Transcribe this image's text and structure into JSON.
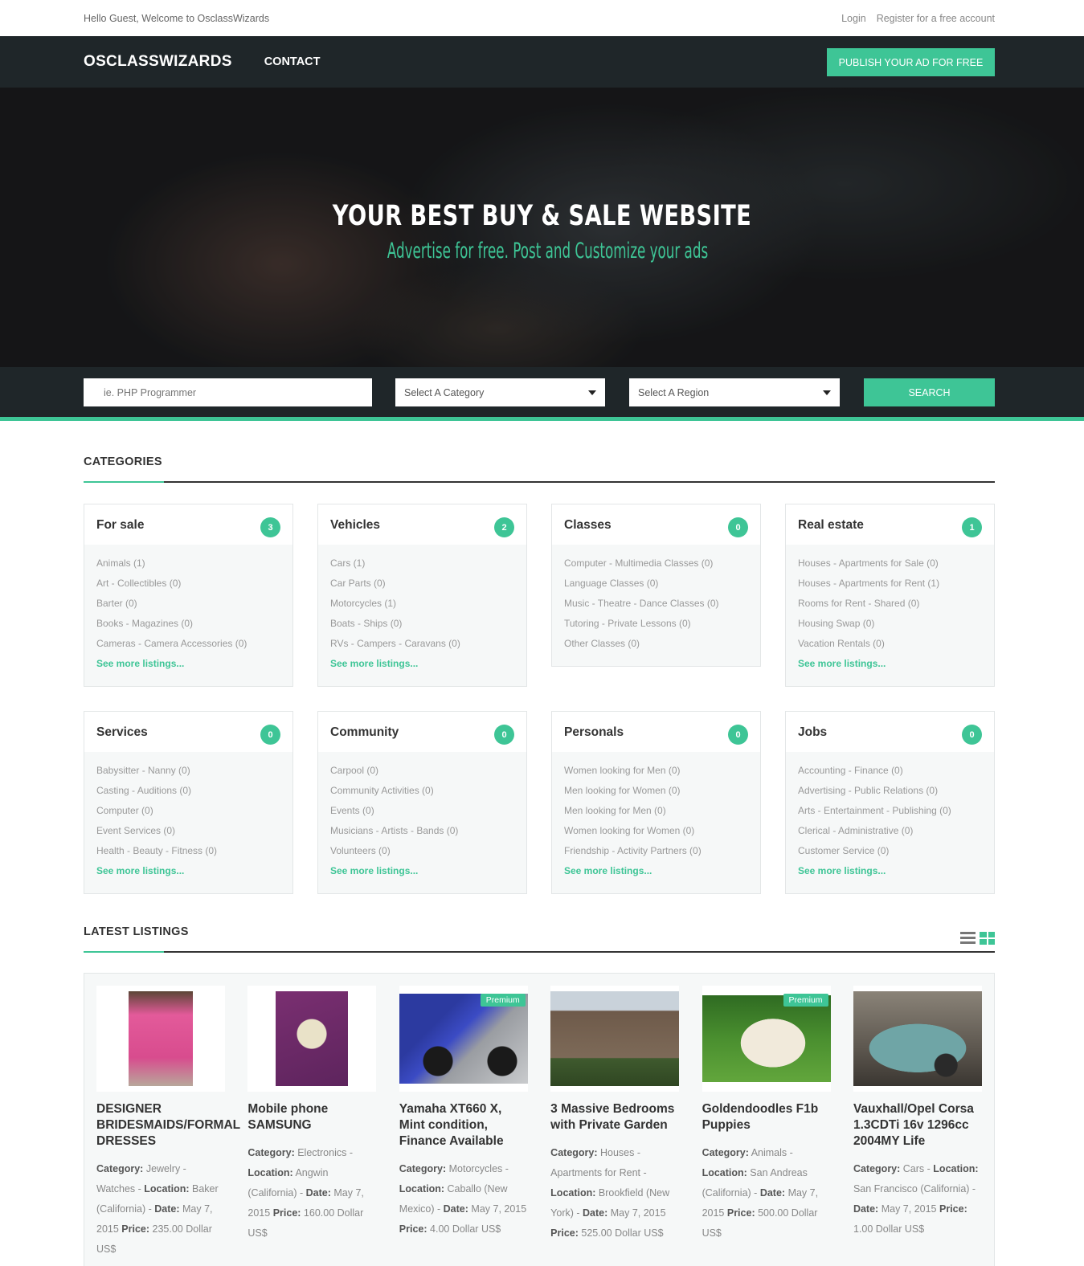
{
  "topbar": {
    "welcome": "Hello Guest, Welcome to OsclassWizards",
    "login": "Login",
    "register": "Register for a free account"
  },
  "nav": {
    "brand": "OSCLASSWIZARDS",
    "contact": "CONTACT",
    "publish": "PUBLISH YOUR AD FOR FREE"
  },
  "hero": {
    "title": "YOUR BEST BUY & SALE WEBSITE",
    "subtitle": "Advertise for free. Post and Customize your ads"
  },
  "search": {
    "placeholder": "ie. PHP Programmer",
    "category": "Select A Category",
    "region": "Select A Region",
    "button": "SEARCH"
  },
  "categories": {
    "heading": "CATEGORIES",
    "items": [
      {
        "name": "For sale",
        "count": "3",
        "subs": [
          "Animals (1)",
          "Art - Collectibles (0)",
          "Barter (0)",
          "Books - Magazines (0)",
          "Cameras - Camera Accessories (0)"
        ],
        "more": "See more listings..."
      },
      {
        "name": "Vehicles",
        "count": "2",
        "subs": [
          "Cars (1)",
          "Car Parts (0)",
          "Motorcycles (1)",
          "Boats - Ships (0)",
          "RVs - Campers - Caravans (0)"
        ],
        "more": "See more listings..."
      },
      {
        "name": "Classes",
        "count": "0",
        "subs": [
          "Computer - Multimedia Classes (0)",
          "Language Classes (0)",
          "Music - Theatre - Dance Classes (0)",
          "Tutoring - Private Lessons (0)",
          "Other Classes (0)"
        ],
        "more": ""
      },
      {
        "name": "Real estate",
        "count": "1",
        "subs": [
          "Houses - Apartments for Sale (0)",
          "Houses - Apartments for Rent (1)",
          "Rooms for Rent - Shared (0)",
          "Housing Swap (0)",
          "Vacation Rentals (0)"
        ],
        "more": "See more listings..."
      },
      {
        "name": "Services",
        "count": "0",
        "subs": [
          "Babysitter - Nanny (0)",
          "Casting - Auditions (0)",
          "Computer (0)",
          "Event Services (0)",
          "Health - Beauty - Fitness (0)"
        ],
        "more": "See more listings..."
      },
      {
        "name": "Community",
        "count": "0",
        "subs": [
          "Carpool (0)",
          "Community Activities (0)",
          "Events (0)",
          "Musicians - Artists - Bands (0)",
          "Volunteers (0)"
        ],
        "more": "See more listings..."
      },
      {
        "name": "Personals",
        "count": "0",
        "subs": [
          "Women looking for Men (0)",
          "Men looking for Women (0)",
          "Men looking for Men (0)",
          "Women looking for Women (0)",
          "Friendship - Activity Partners (0)"
        ],
        "more": "See more listings..."
      },
      {
        "name": "Jobs",
        "count": "0",
        "subs": [
          "Accounting - Finance (0)",
          "Advertising - Public Relations (0)",
          "Arts - Entertainment - Publishing (0)",
          "Clerical - Administrative (0)",
          "Customer Service (0)"
        ],
        "more": "See more listings..."
      }
    ]
  },
  "latest": {
    "heading": "LATEST LISTINGS",
    "labels": {
      "category": "Category:",
      "location": "Location:",
      "date": "Date:",
      "price": "Price:"
    },
    "items": [
      {
        "title": "DESIGNER BRIDESMAIDS/FORMAL DRESSES",
        "category": "Jewelry - Watches",
        "location": "Baker (California)",
        "date": "May 7, 2015",
        "price": "235.00 Dollar US$",
        "premium": "",
        "photo": "dress-photo"
      },
      {
        "title": "Mobile phone SAMSUNG",
        "category": "Electronics",
        "location": "Angwin (California)",
        "date": "May 7, 2015",
        "price": "160.00 Dollar US$",
        "premium": "",
        "photo": "phone-photo"
      },
      {
        "title": "Yamaha XT660 X, Mint condition, Finance Available",
        "category": "Motorcycles",
        "location": "Caballo (New Mexico)",
        "date": "May 7, 2015",
        "price": "4.00 Dollar US$",
        "premium": "Premium",
        "photo": "motorcycle-photo"
      },
      {
        "title": "3 Massive Bedrooms with Private Garden",
        "category": "Houses - Apartments for Rent",
        "location": "Brookfield (New York)",
        "date": "May 7, 2015",
        "price": "525.00 Dollar US$",
        "premium": "",
        "photo": "house-photo"
      },
      {
        "title": "Goldendoodles F1b Puppies",
        "category": "Animals",
        "location": "San Andreas (California)",
        "date": "May 7, 2015",
        "price": "500.00 Dollar US$",
        "premium": "Premium",
        "photo": "puppy-photo"
      },
      {
        "title": "Vauxhall/Opel Corsa 1.3CDTi 16v 1296cc 2004MY Life",
        "category": "Cars",
        "location": "San Francisco (California)",
        "date": "May 7, 2015",
        "price": "1.00 Dollar US$",
        "premium": "",
        "photo": "car-photo"
      }
    ]
  },
  "colors": {
    "accent": "#3ec596",
    "dark": "#1f2629"
  }
}
